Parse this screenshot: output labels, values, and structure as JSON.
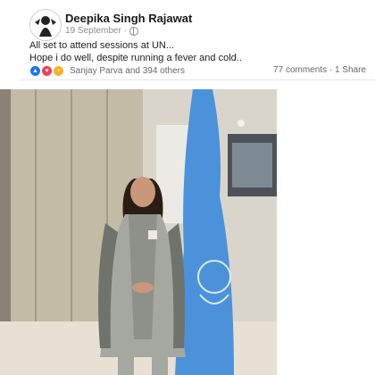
{
  "post": {
    "author": "Deepika Singh Rajawat",
    "date": "19 September",
    "separator": "·",
    "text_line1": "All set to attend sessions at UN...",
    "text_line2": "Hope i do well, despite running a fever and cold..",
    "reactions_text": "Sanjay Parva and 394 others",
    "comments": "77 comments",
    "shares": "1 Share"
  },
  "icons": [
    "globe-icon",
    "like-reaction-icon",
    "love-reaction-icon",
    "wow-reaction-icon"
  ],
  "colors": {
    "like": "#1877f2",
    "love": "#f33e58",
    "wow": "#f7b125",
    "flag": "#4b92db"
  }
}
